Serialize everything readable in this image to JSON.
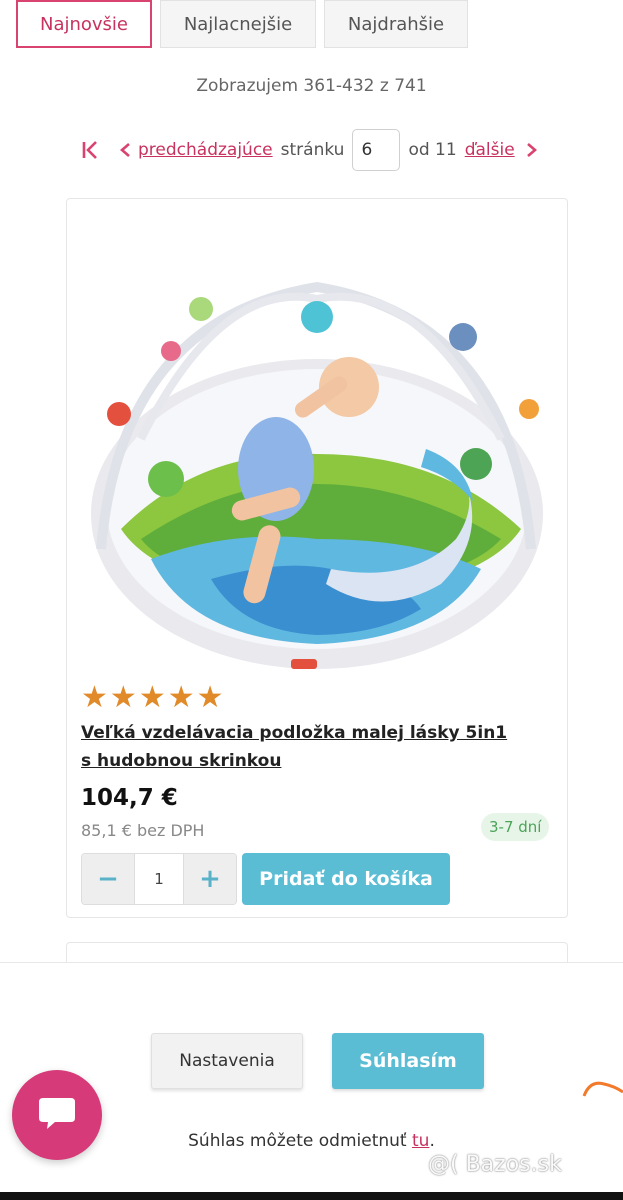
{
  "sort": {
    "tabs": [
      {
        "label": "Najnovšie",
        "active": true
      },
      {
        "label": "Najlacnejšie",
        "active": false
      },
      {
        "label": "Najdrahšie",
        "active": false
      }
    ]
  },
  "results_text": "Zobrazujem 361-432 z 741",
  "pagination": {
    "prev_label": "predchádzajúce",
    "page_word": "stránku",
    "current_page": "6",
    "of_text": "od 11",
    "next_label": "ďalšie"
  },
  "product": {
    "rating": 5,
    "title": "Veľká vzdelávacia podložka malej lásky 5in1 s hudobnou skrinkou",
    "price": "104,7 €",
    "price_net": "85,1 € bez DPH",
    "delivery": "3-7 dní",
    "quantity": "1",
    "add_to_cart": "Pridať do košíka"
  },
  "cookie": {
    "settings_label": "Nastavenia",
    "accept_label": "Súhlasím",
    "decline_text": "Súhlas môžete odmietnuť ",
    "decline_link": "tu",
    "decline_end": "."
  },
  "watermark": "@( Bazos.sk",
  "colors": {
    "accent_pink": "#d9436f",
    "button_blue": "#5bbdd4",
    "star": "#e08a2a",
    "chat": "#d63a78"
  }
}
